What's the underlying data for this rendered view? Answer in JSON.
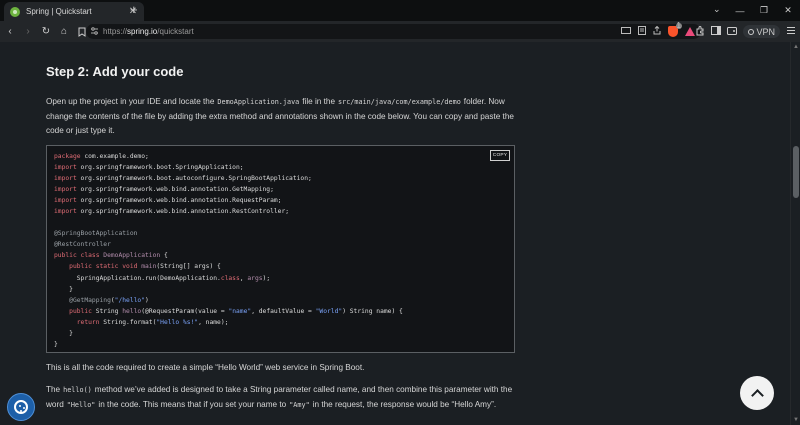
{
  "browser": {
    "tab": {
      "title": "Spring | Quickstart",
      "close": "✕"
    },
    "new_tab": "+",
    "window": {
      "chevron": "⌄",
      "minimize": "—",
      "restore": "❐",
      "close": "✕"
    },
    "nav": {
      "back": "‹",
      "forward": "›",
      "reload": "↻",
      "home": "⌂",
      "bookmark": "🔖"
    },
    "url": {
      "scheme": "https://",
      "host": "spring.io",
      "path": "/quickstart"
    },
    "shield_count": "1",
    "vpn_label": "VPN"
  },
  "content": {
    "step_title": "Step 2: Add your code",
    "p1": {
      "a": "Open up the project in your IDE and locate the",
      "code1": "DemoApplication.java",
      "b": "file in the",
      "code2": "src/main/java/com/example/demo",
      "c": "folder. Now change the contents of the file by adding the extra method and annotations shown in the code below. You can copy and paste the code or just type it."
    },
    "copy_label": "COPY",
    "code": {
      "l1_kw": "package",
      "l1_rest": " com.example.demo;",
      "l2_kw": "import",
      "l2_rest": " org.springframework.boot.SpringApplication;",
      "l3_kw": "import",
      "l3_rest": " org.springframework.boot.autoconfigure.SpringBootApplication;",
      "l4_kw": "import",
      "l4_rest": " org.springframework.web.bind.annotation.GetMapping;",
      "l5_kw": "import",
      "l5_rest": " org.springframework.web.bind.annotation.RequestParam;",
      "l6_kw": "import",
      "l6_rest": " org.springframework.web.bind.annotation.RestController;",
      "l7": "@SpringBootApplication",
      "l8": "@RestController",
      "l9_kw": "public class",
      "l9_cls": "DemoApplication",
      "l9_rest": " {",
      "l10_kw": "public static void",
      "l10_fn": "main",
      "l10_rest": "(String[] args) {",
      "l11_a": "SpringApplication.run(DemoApplication.",
      "l11_kw": "class",
      "l11_b": ", ",
      "l11_arg": "args",
      "l11_c": ");",
      "l12": "}",
      "l13_ann": "@GetMapping",
      "l13_a": "(",
      "l13_str": "\"/hello\"",
      "l13_b": ")",
      "l14_kw": "public",
      "l14_a": " String ",
      "l14_fn": "hello",
      "l14_b": "(@RequestParam(value = ",
      "l14_s1": "\"name\"",
      "l14_c": ", defaultValue = ",
      "l14_s2": "\"World\"",
      "l14_d": ") String name) {",
      "l15_kw": "return",
      "l15_a": " String.format(",
      "l15_str": "\"Hello %s!\"",
      "l15_b": ", name);",
      "l16": "}",
      "l17": "}"
    },
    "p2": "This is all the code required to create a simple “Hello World” web service in Spring Boot.",
    "p3": {
      "a": "The",
      "code1": "hello()",
      "b": "method we’ve added is designed to take a String parameter called name, and then combine this parameter with the word",
      "code2": "\"Hello\"",
      "c": "in the code. This means that if you set your name to",
      "code3": "\"Amy\"",
      "d": "in the request, the response would be “Hello Amy”."
    }
  }
}
